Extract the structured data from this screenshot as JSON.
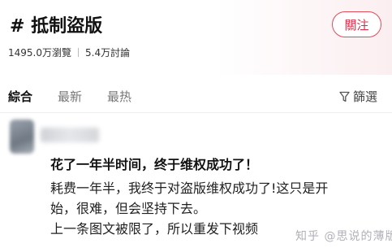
{
  "topic": {
    "title": "# 抵制盜版",
    "follow_label": "關注",
    "views": "1495.0万瀏覽",
    "discussions": "5.4万討論"
  },
  "tabs": [
    "綜合",
    "最新",
    "最热"
  ],
  "filter_label": "篩選",
  "post": {
    "title": "花了一年半时间，终于维权成功了！",
    "body_lines": [
      "耗费一年半，我终于对盗版维权成功了!这只是开",
      "始，很难，但会坚持下去。",
      "上一条图文被限了，所以重发下视频"
    ]
  },
  "watermark": "知乎 @思说的薄版权",
  "colors": {
    "accent": "#d6304a",
    "header_tint": "#fbeef0"
  }
}
